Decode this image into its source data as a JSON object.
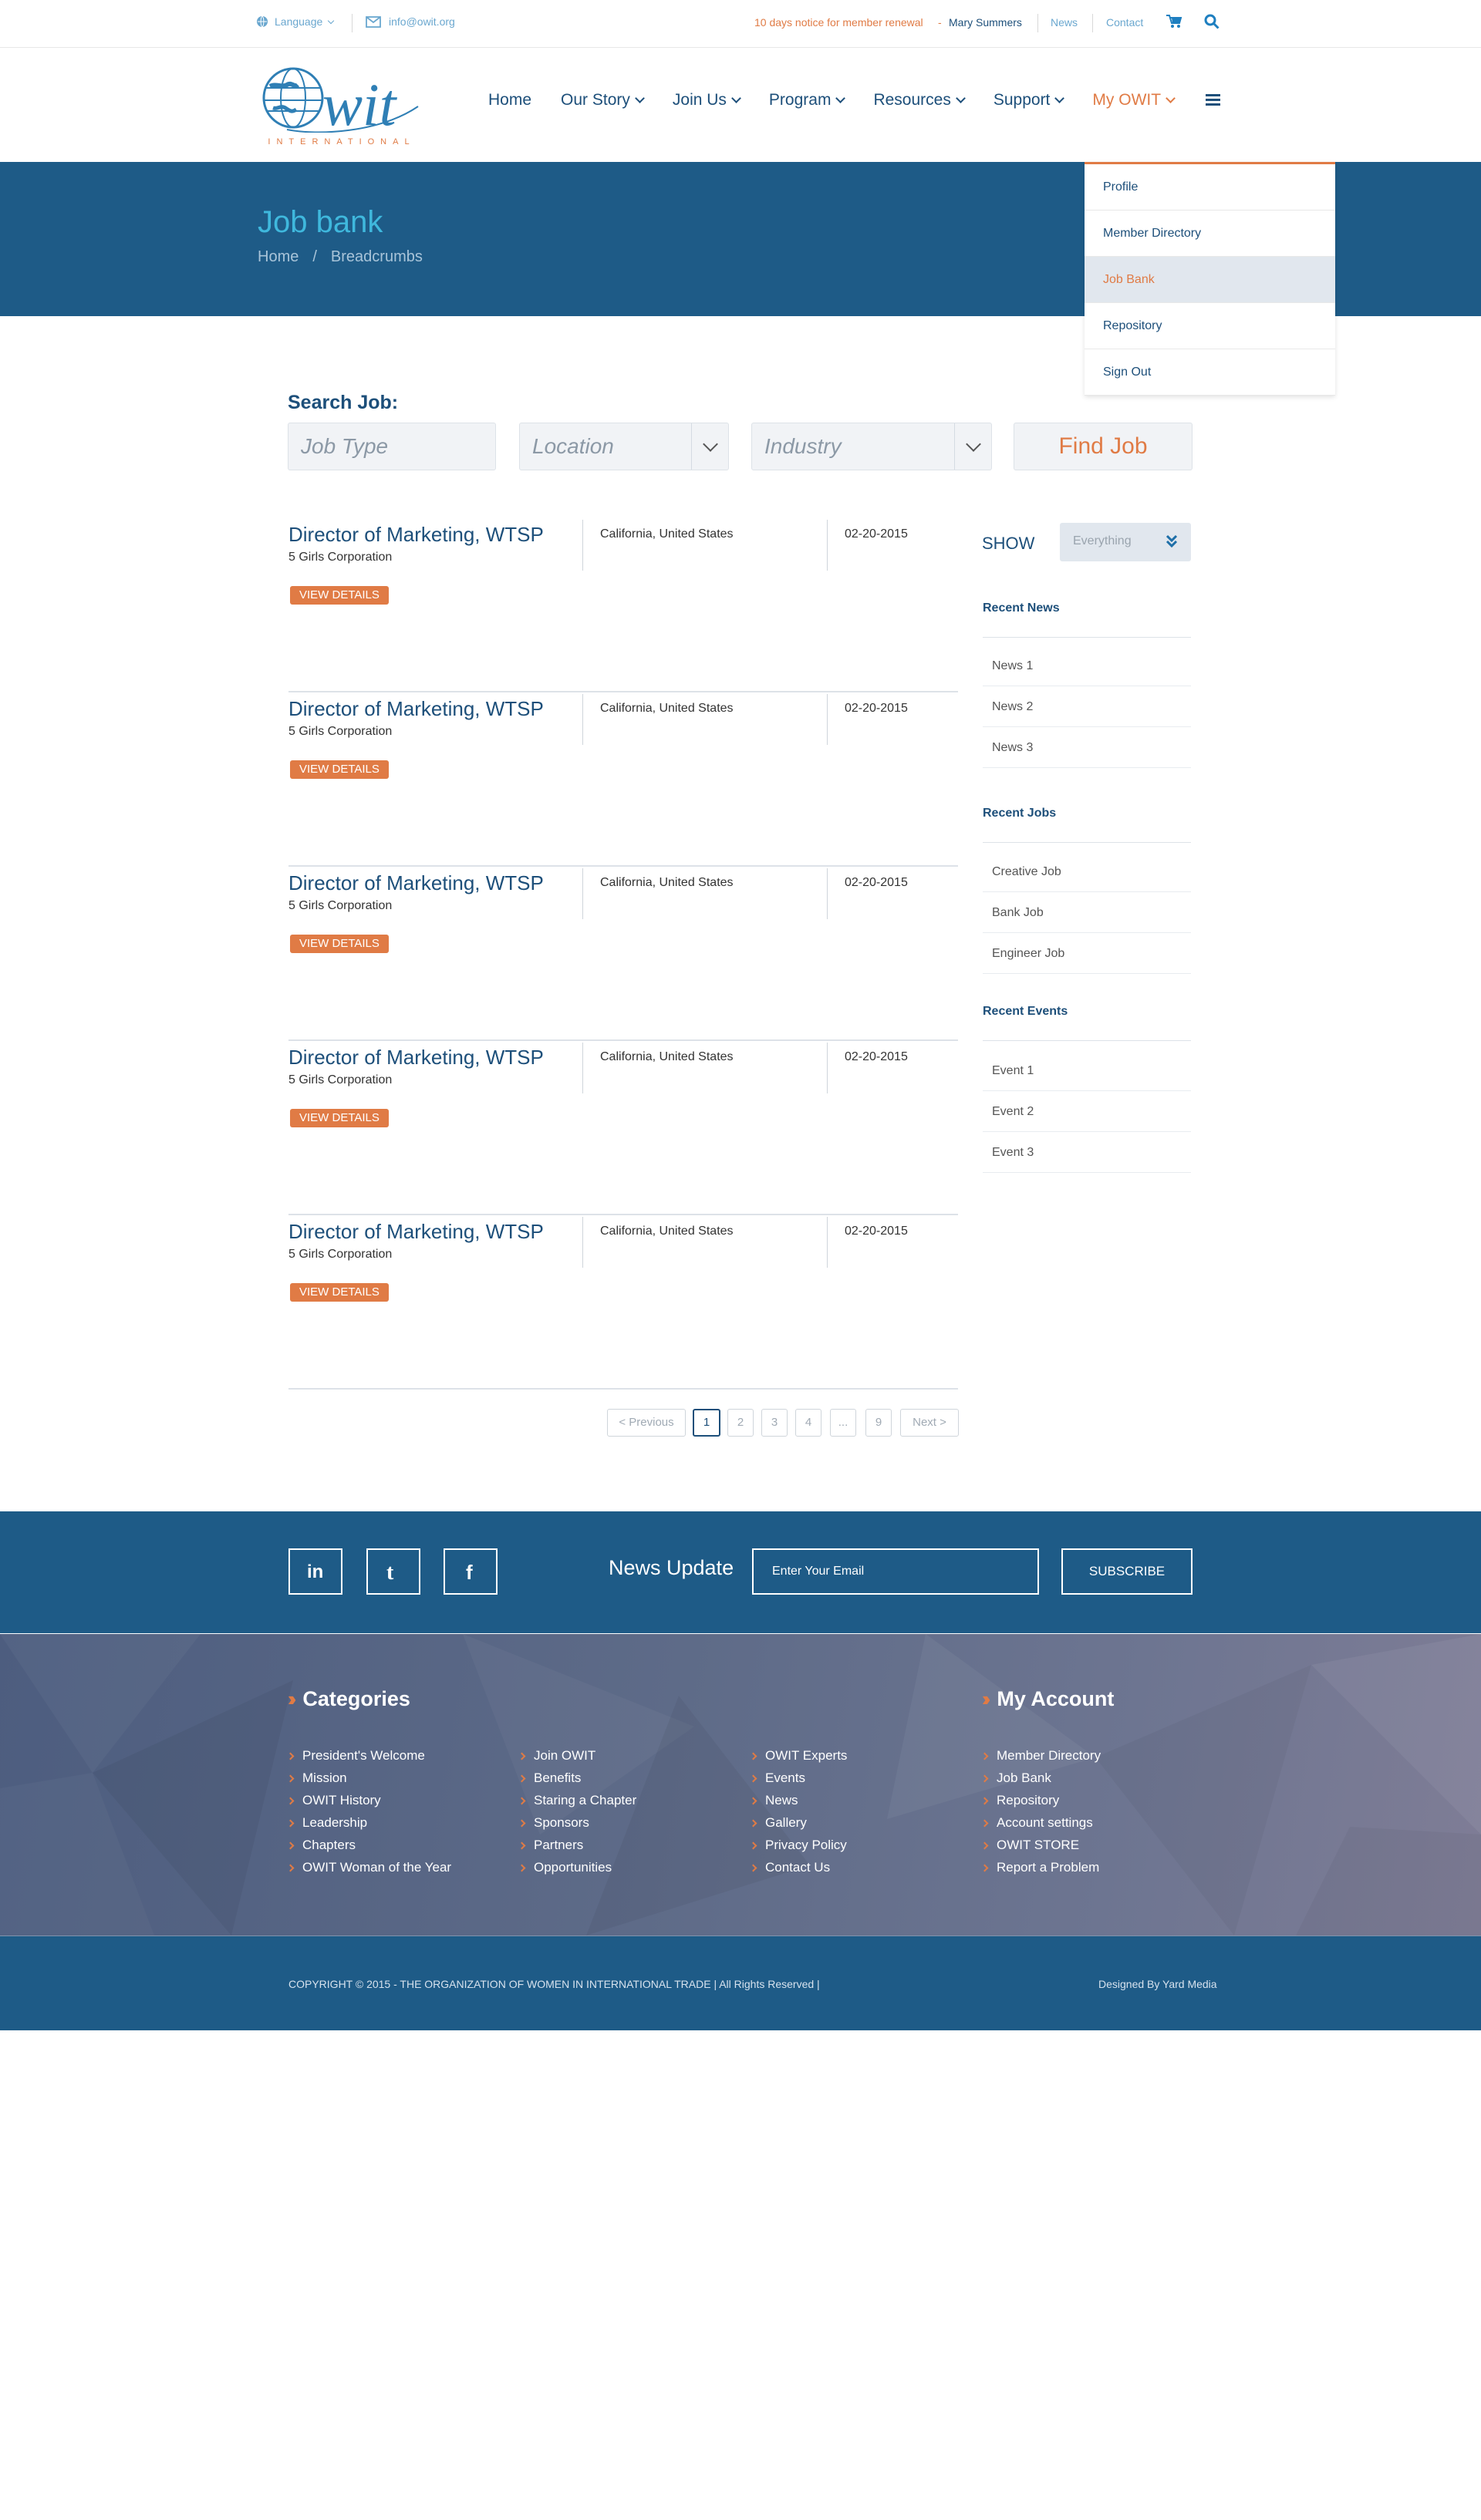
{
  "topbar": {
    "language": "Language",
    "email": "info@owit.org",
    "notice": "10 days notice for member renewal",
    "dash": "-",
    "user": "Mary Summers",
    "links": [
      "News",
      "Contact"
    ]
  },
  "logo": {
    "text": "Owit",
    "tagline": "INTERNATIONAL"
  },
  "nav": {
    "items": [
      {
        "label": "Home"
      },
      {
        "label": "Our Story"
      },
      {
        "label": "Join Us"
      },
      {
        "label": "Program"
      },
      {
        "label": "Resources"
      },
      {
        "label": "Support"
      },
      {
        "label": "My OWIT"
      }
    ]
  },
  "hero": {
    "title": "Job bank",
    "crumbs": [
      "Home",
      "/",
      "Breadcrumbs"
    ]
  },
  "dropdown": {
    "items": [
      "Profile",
      "Member Directory",
      "Job Bank",
      "Repository",
      "Sign Out"
    ],
    "active": "Job Bank"
  },
  "search": {
    "label": "Search Job:",
    "job_type_placeholder": "Job Type",
    "location_placeholder": "Location",
    "industry_placeholder": "Industry",
    "button": "Find Job"
  },
  "jobs": [
    {
      "title": "Director of Marketing, WTSP",
      "company": "5 Girls Corporation",
      "location": "California, United States",
      "date": "02-20-2015",
      "action": "VIEW DETAILS"
    },
    {
      "title": "Director of Marketing, WTSP",
      "company": "5 Girls Corporation",
      "location": "California, United States",
      "date": "02-20-2015",
      "action": "VIEW DETAILS"
    },
    {
      "title": "Director of Marketing, WTSP",
      "company": "5 Girls Corporation",
      "location": "California, United States",
      "date": "02-20-2015",
      "action": "VIEW DETAILS"
    },
    {
      "title": "Director of Marketing, WTSP",
      "company": "5 Girls Corporation",
      "location": "California, United States",
      "date": "02-20-2015",
      "action": "VIEW DETAILS"
    },
    {
      "title": "Director of Marketing, WTSP",
      "company": "5 Girls Corporation",
      "location": "California, United States",
      "date": "02-20-2015",
      "action": "VIEW DETAILS"
    }
  ],
  "sidebar": {
    "show_label": "SHOW",
    "show_value": "Everything",
    "sections": [
      {
        "title": "Recent News",
        "items": [
          "News 1",
          "News 2",
          "News 3"
        ]
      },
      {
        "title": "Recent Jobs",
        "items": [
          "Creative Job",
          "Bank Job",
          "Engineer Job"
        ]
      },
      {
        "title": "Recent Events",
        "items": [
          "Event 1",
          "Event 2",
          "Event 3"
        ]
      }
    ]
  },
  "pagination": {
    "prev": "< Previous",
    "pages": [
      "1",
      "2",
      "3",
      "4",
      "...",
      "9"
    ],
    "current": "1",
    "next": "Next >"
  },
  "newsletter": {
    "title": "News Update",
    "placeholder": "Enter Your Email",
    "button": "SUBSCRIBE"
  },
  "footer": {
    "categories_title": "Categories",
    "account_title": "My Account",
    "col1": [
      "President's Welcome",
      "Mission",
      "OWIT History",
      "Leadership",
      "Chapters",
      "OWIT Woman of the Year"
    ],
    "col2": [
      "Join OWIT",
      "Benefits",
      "Staring a Chapter",
      "Sponsors",
      "Partners",
      "Opportunities"
    ],
    "col3": [
      "OWIT Experts",
      "Events",
      "News",
      "Gallery",
      "Privacy Policy",
      "Contact Us"
    ],
    "col4": [
      "Member Directory",
      "Job Bank",
      "Repository",
      "Account settings",
      "OWIT STORE",
      "Report a Problem"
    ],
    "copyright": "COPYRIGHT © 2015 - THE ORGANIZATION OF WOMEN IN INTERNATIONAL TRADE  |  All Rights Reserved  |",
    "designed_by": "Designed By Yard Media"
  },
  "colors": {
    "primary": "#1e5b87",
    "accent": "#e07b45",
    "link_light": "#6aa7cf",
    "hero_title": "#3fb8dd"
  },
  "icons": {
    "language": "globe-icon",
    "email": "envelope-icon",
    "cart": "cart-icon",
    "search": "search-icon",
    "menu": "hamburger-icon",
    "social": [
      "linkedin-icon",
      "twitter-icon",
      "facebook-icon"
    ]
  }
}
